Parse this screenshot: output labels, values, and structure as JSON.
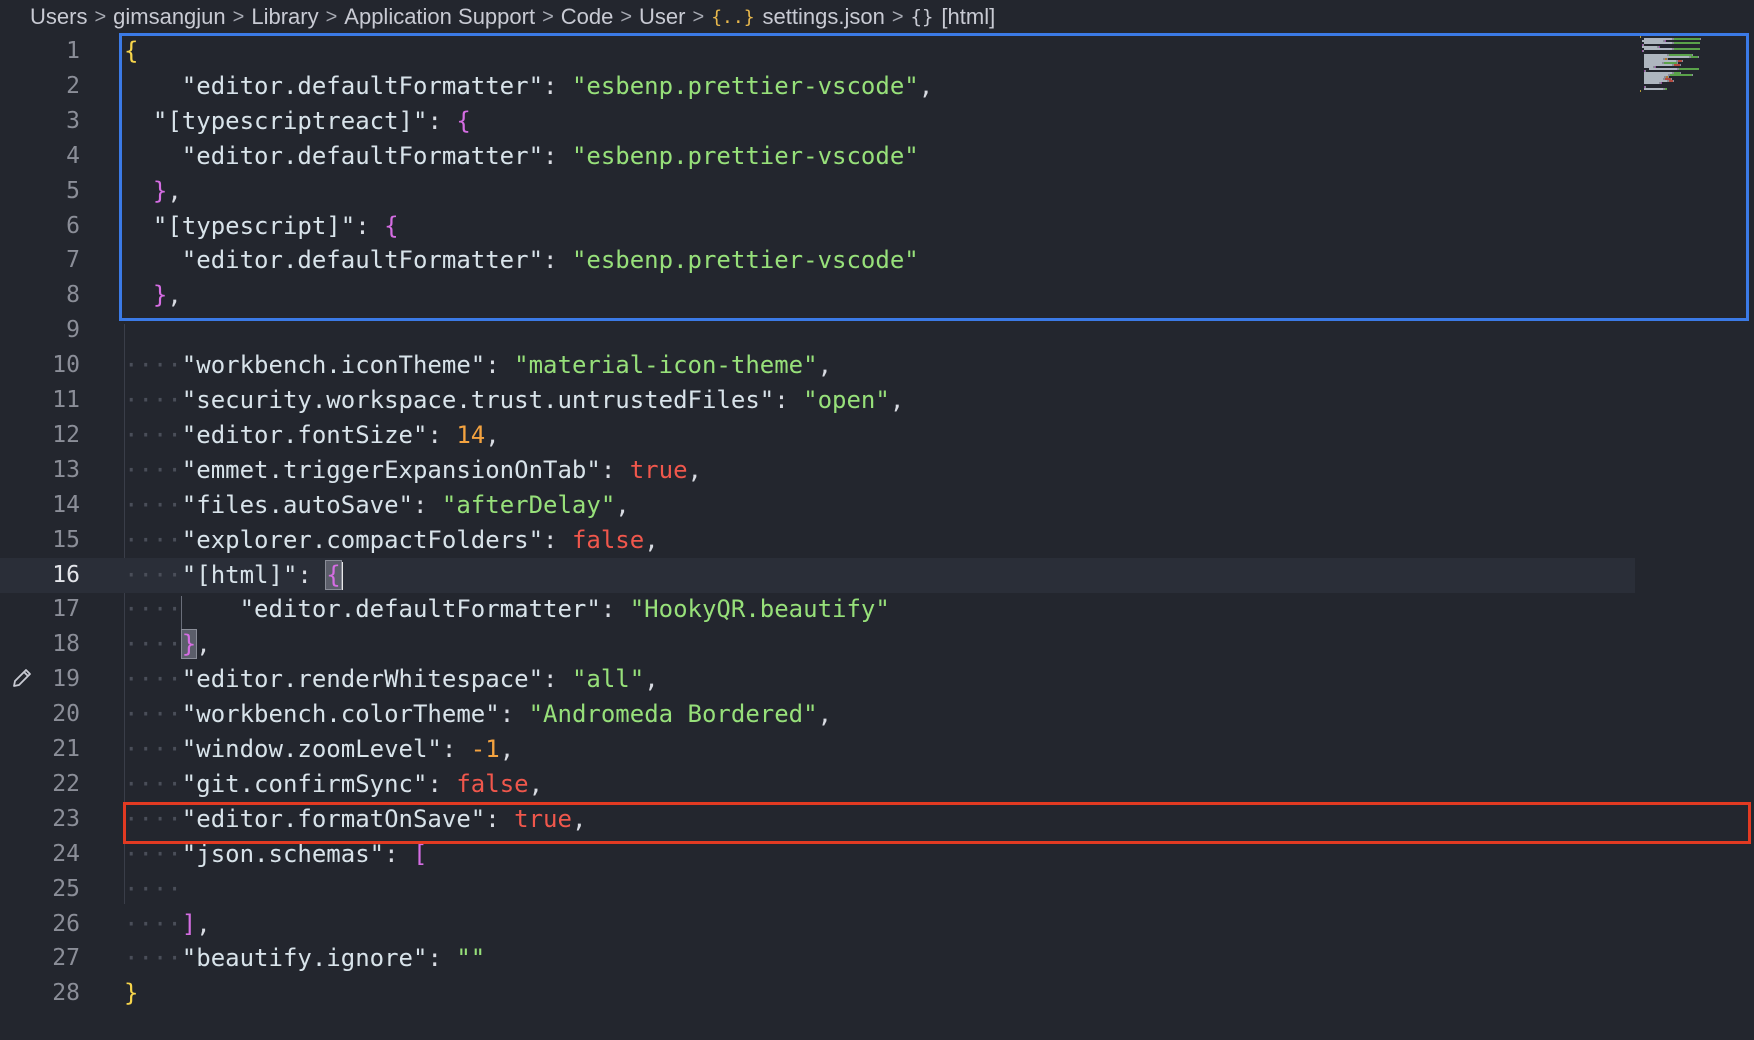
{
  "breadcrumb": {
    "items": [
      "Users",
      "gimsangjun",
      "Library",
      "Application Support",
      "Code",
      "User"
    ],
    "file_icon": "{..}",
    "file": "settings.json",
    "symbol_icon": "{}",
    "symbol": "[html]",
    "separator": ">"
  },
  "editor": {
    "active_line": 16,
    "lines": [
      {
        "n": "1",
        "tokens": [
          [
            "y",
            "{"
          ]
        ]
      },
      {
        "n": "2",
        "tokens": [
          [
            "ws",
            "    "
          ],
          [
            "k",
            "\"editor.defaultFormatter\""
          ],
          [
            "p",
            ": "
          ],
          [
            "s",
            "\"esbenp.prettier-vscode\""
          ],
          [
            "p",
            ","
          ]
        ]
      },
      {
        "n": "3",
        "tokens": [
          [
            "ws",
            "  "
          ],
          [
            "k",
            "\"[typescriptreact]\""
          ],
          [
            "p",
            ": "
          ],
          [
            "m",
            "{"
          ]
        ]
      },
      {
        "n": "4",
        "tokens": [
          [
            "ws",
            "    "
          ],
          [
            "k",
            "\"editor.defaultFormatter\""
          ],
          [
            "p",
            ": "
          ],
          [
            "s",
            "\"esbenp.prettier-vscode\""
          ]
        ]
      },
      {
        "n": "5",
        "tokens": [
          [
            "ws",
            "  "
          ],
          [
            "m",
            "}"
          ],
          [
            "p",
            ","
          ]
        ]
      },
      {
        "n": "6",
        "tokens": [
          [
            "ws",
            "  "
          ],
          [
            "k",
            "\"[typescript]\""
          ],
          [
            "p",
            ": "
          ],
          [
            "m",
            "{"
          ]
        ]
      },
      {
        "n": "7",
        "tokens": [
          [
            "ws",
            "    "
          ],
          [
            "k",
            "\"editor.defaultFormatter\""
          ],
          [
            "p",
            ": "
          ],
          [
            "s",
            "\"esbenp.prettier-vscode\""
          ]
        ]
      },
      {
        "n": "8",
        "tokens": [
          [
            "ws",
            "  "
          ],
          [
            "m",
            "}"
          ],
          [
            "p",
            ","
          ]
        ]
      },
      {
        "n": "9",
        "tokens": []
      },
      {
        "n": "10",
        "tokens": [
          [
            "ws",
            "····"
          ],
          [
            "k",
            "\"workbench.iconTheme\""
          ],
          [
            "p",
            ": "
          ],
          [
            "s",
            "\"material-icon-theme\""
          ],
          [
            "p",
            ","
          ]
        ]
      },
      {
        "n": "11",
        "tokens": [
          [
            "ws",
            "····"
          ],
          [
            "k",
            "\"security.workspace.trust.untrustedFiles\""
          ],
          [
            "p",
            ": "
          ],
          [
            "s",
            "\"open\""
          ],
          [
            "p",
            ","
          ]
        ]
      },
      {
        "n": "12",
        "tokens": [
          [
            "ws",
            "····"
          ],
          [
            "k",
            "\"editor.fontSize\""
          ],
          [
            "p",
            ": "
          ],
          [
            "n",
            "14"
          ],
          [
            "p",
            ","
          ]
        ]
      },
      {
        "n": "13",
        "tokens": [
          [
            "ws",
            "····"
          ],
          [
            "k",
            "\"emmet.triggerExpansionOnTab\""
          ],
          [
            "p",
            ": "
          ],
          [
            "b",
            "true"
          ],
          [
            "p",
            ","
          ]
        ]
      },
      {
        "n": "14",
        "tokens": [
          [
            "ws",
            "····"
          ],
          [
            "k",
            "\"files.autoSave\""
          ],
          [
            "p",
            ": "
          ],
          [
            "s",
            "\"afterDelay\""
          ],
          [
            "p",
            ","
          ]
        ]
      },
      {
        "n": "15",
        "tokens": [
          [
            "ws",
            "····"
          ],
          [
            "k",
            "\"explorer.compactFolders\""
          ],
          [
            "p",
            ": "
          ],
          [
            "b",
            "false"
          ],
          [
            "p",
            ","
          ]
        ]
      },
      {
        "n": "16",
        "tokens": [
          [
            "ws",
            "····"
          ],
          [
            "k",
            "\"[html]\""
          ],
          [
            "p",
            ": "
          ],
          [
            "mh",
            "{"
          ],
          [
            "cur",
            ""
          ]
        ]
      },
      {
        "n": "17",
        "tokens": [
          [
            "ws",
            "····    "
          ],
          [
            "k",
            "\"editor.defaultFormatter\""
          ],
          [
            "p",
            ": "
          ],
          [
            "s",
            "\"HookyQR.beautify\""
          ]
        ]
      },
      {
        "n": "18",
        "tokens": [
          [
            "ws",
            "····"
          ],
          [
            "mh",
            "}"
          ],
          [
            "p",
            ","
          ]
        ]
      },
      {
        "n": "19",
        "tokens": [
          [
            "ws",
            "····"
          ],
          [
            "k",
            "\"editor.renderWhitespace\""
          ],
          [
            "p",
            ": "
          ],
          [
            "s",
            "\"all\""
          ],
          [
            "p",
            ","
          ]
        ]
      },
      {
        "n": "20",
        "tokens": [
          [
            "ws",
            "····"
          ],
          [
            "k",
            "\"workbench.colorTheme\""
          ],
          [
            "p",
            ": "
          ],
          [
            "s",
            "\"Andromeda Bordered\""
          ],
          [
            "p",
            ","
          ]
        ]
      },
      {
        "n": "21",
        "tokens": [
          [
            "ws",
            "····"
          ],
          [
            "k",
            "\"window.zoomLevel\""
          ],
          [
            "p",
            ": "
          ],
          [
            "n",
            "-1"
          ],
          [
            "p",
            ","
          ]
        ]
      },
      {
        "n": "22",
        "tokens": [
          [
            "ws",
            "····"
          ],
          [
            "k",
            "\"git.confirmSync\""
          ],
          [
            "p",
            ": "
          ],
          [
            "b",
            "false"
          ],
          [
            "p",
            ","
          ]
        ]
      },
      {
        "n": "23",
        "tokens": [
          [
            "ws",
            "····"
          ],
          [
            "k",
            "\"editor.formatOnSave\""
          ],
          [
            "p",
            ": "
          ],
          [
            "b",
            "true"
          ],
          [
            "p",
            ","
          ]
        ]
      },
      {
        "n": "24",
        "tokens": [
          [
            "ws",
            "····"
          ],
          [
            "k",
            "\"json.schemas\""
          ],
          [
            "p",
            ": "
          ],
          [
            "m",
            "["
          ]
        ]
      },
      {
        "n": "25",
        "tokens": [
          [
            "ws",
            "····"
          ]
        ]
      },
      {
        "n": "26",
        "tokens": [
          [
            "ws",
            "····"
          ],
          [
            "m",
            "]"
          ],
          [
            "p",
            ","
          ]
        ]
      },
      {
        "n": "27",
        "tokens": [
          [
            "ws",
            "····"
          ],
          [
            "k",
            "\"beautify.ignore\""
          ],
          [
            "p",
            ": "
          ],
          [
            "s",
            "\"\""
          ]
        ]
      },
      {
        "n": "28",
        "tokens": [
          [
            "y",
            "}"
          ]
        ]
      }
    ]
  },
  "colors": {
    "background": "#23262e",
    "string": "#97e07a",
    "number": "#f4a340",
    "boolean": "#f0574c",
    "bracket_outer": "#f7d54b",
    "bracket_inner": "#d56de3",
    "blue_box": "#3b7ae6",
    "red_box": "#e23a22"
  },
  "icons": {
    "gutter": "pencil-icon",
    "separator": "chevron-right-icon"
  }
}
